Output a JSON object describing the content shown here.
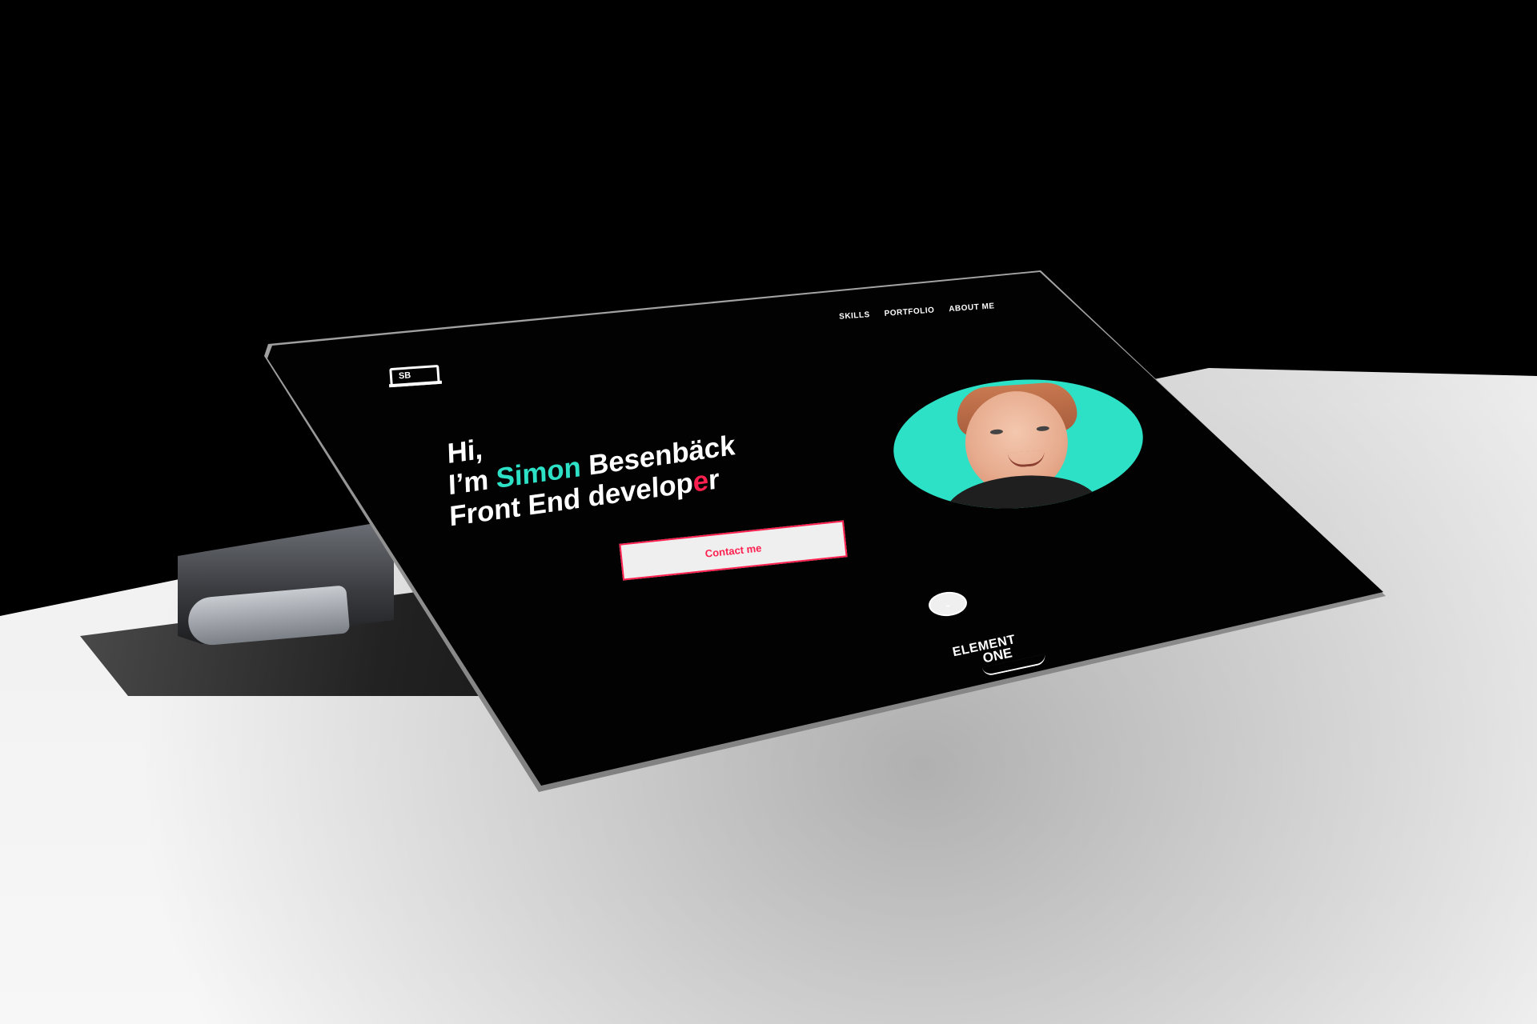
{
  "logo": {
    "text": "SB"
  },
  "nav": {
    "items": [
      {
        "label": "SKILLS"
      },
      {
        "label": "PORTFOLIO"
      },
      {
        "label": "ABOUT ME"
      }
    ]
  },
  "hero": {
    "line1": "Hi,",
    "line2_prefix": "I’m ",
    "line2_accent": "Simon",
    "line2_suffix": " Besenbäck",
    "line3_prefix": "Front End develop",
    "line3_accent": "e",
    "line3_suffix": "r",
    "cta_label": "Contact me"
  },
  "scroll": {
    "icon": "⌄"
  },
  "brand": {
    "top": "ELEMENT",
    "bottom": "ONE"
  },
  "colors": {
    "accent": "#2de1c7",
    "cta": "#ff2050",
    "screen": "#020202",
    "text": "#ffffff"
  }
}
